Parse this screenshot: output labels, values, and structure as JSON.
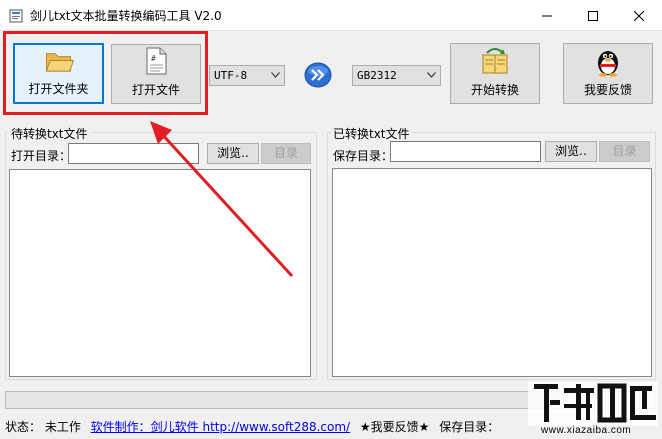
{
  "window": {
    "title": "剑儿txt文本批量转换编码工具 V2.0"
  },
  "toolbar": {
    "open_folder_label": "打开文件夹",
    "open_file_label": "打开文件",
    "start_convert_label": "开始转换",
    "feedback_label": "我要反馈",
    "source_encoding": "UTF-8",
    "target_encoding": "GB2312"
  },
  "left_panel": {
    "title": "待转换txt文件",
    "dir_label": "打开目录：",
    "dir_value": "",
    "browse_label": "浏览..",
    "dir_button_label": "目录"
  },
  "right_panel": {
    "title": "已转换txt文件",
    "dir_label": "保存目录：",
    "dir_value": "",
    "browse_label": "浏览..",
    "dir_button_label": "目录"
  },
  "statusbar": {
    "state": "状态： 未工作",
    "author_link": "软件制作：剑儿软件  http://www.soft288.com/",
    "feedback": "★我要反馈★",
    "save_dir": "保存目录："
  },
  "watermark": {
    "text": "www.xiazaiba.com"
  },
  "colors": {
    "annotation_red": "#e21d24",
    "focus_blue": "#0078d7",
    "link_blue": "#0000ee"
  }
}
